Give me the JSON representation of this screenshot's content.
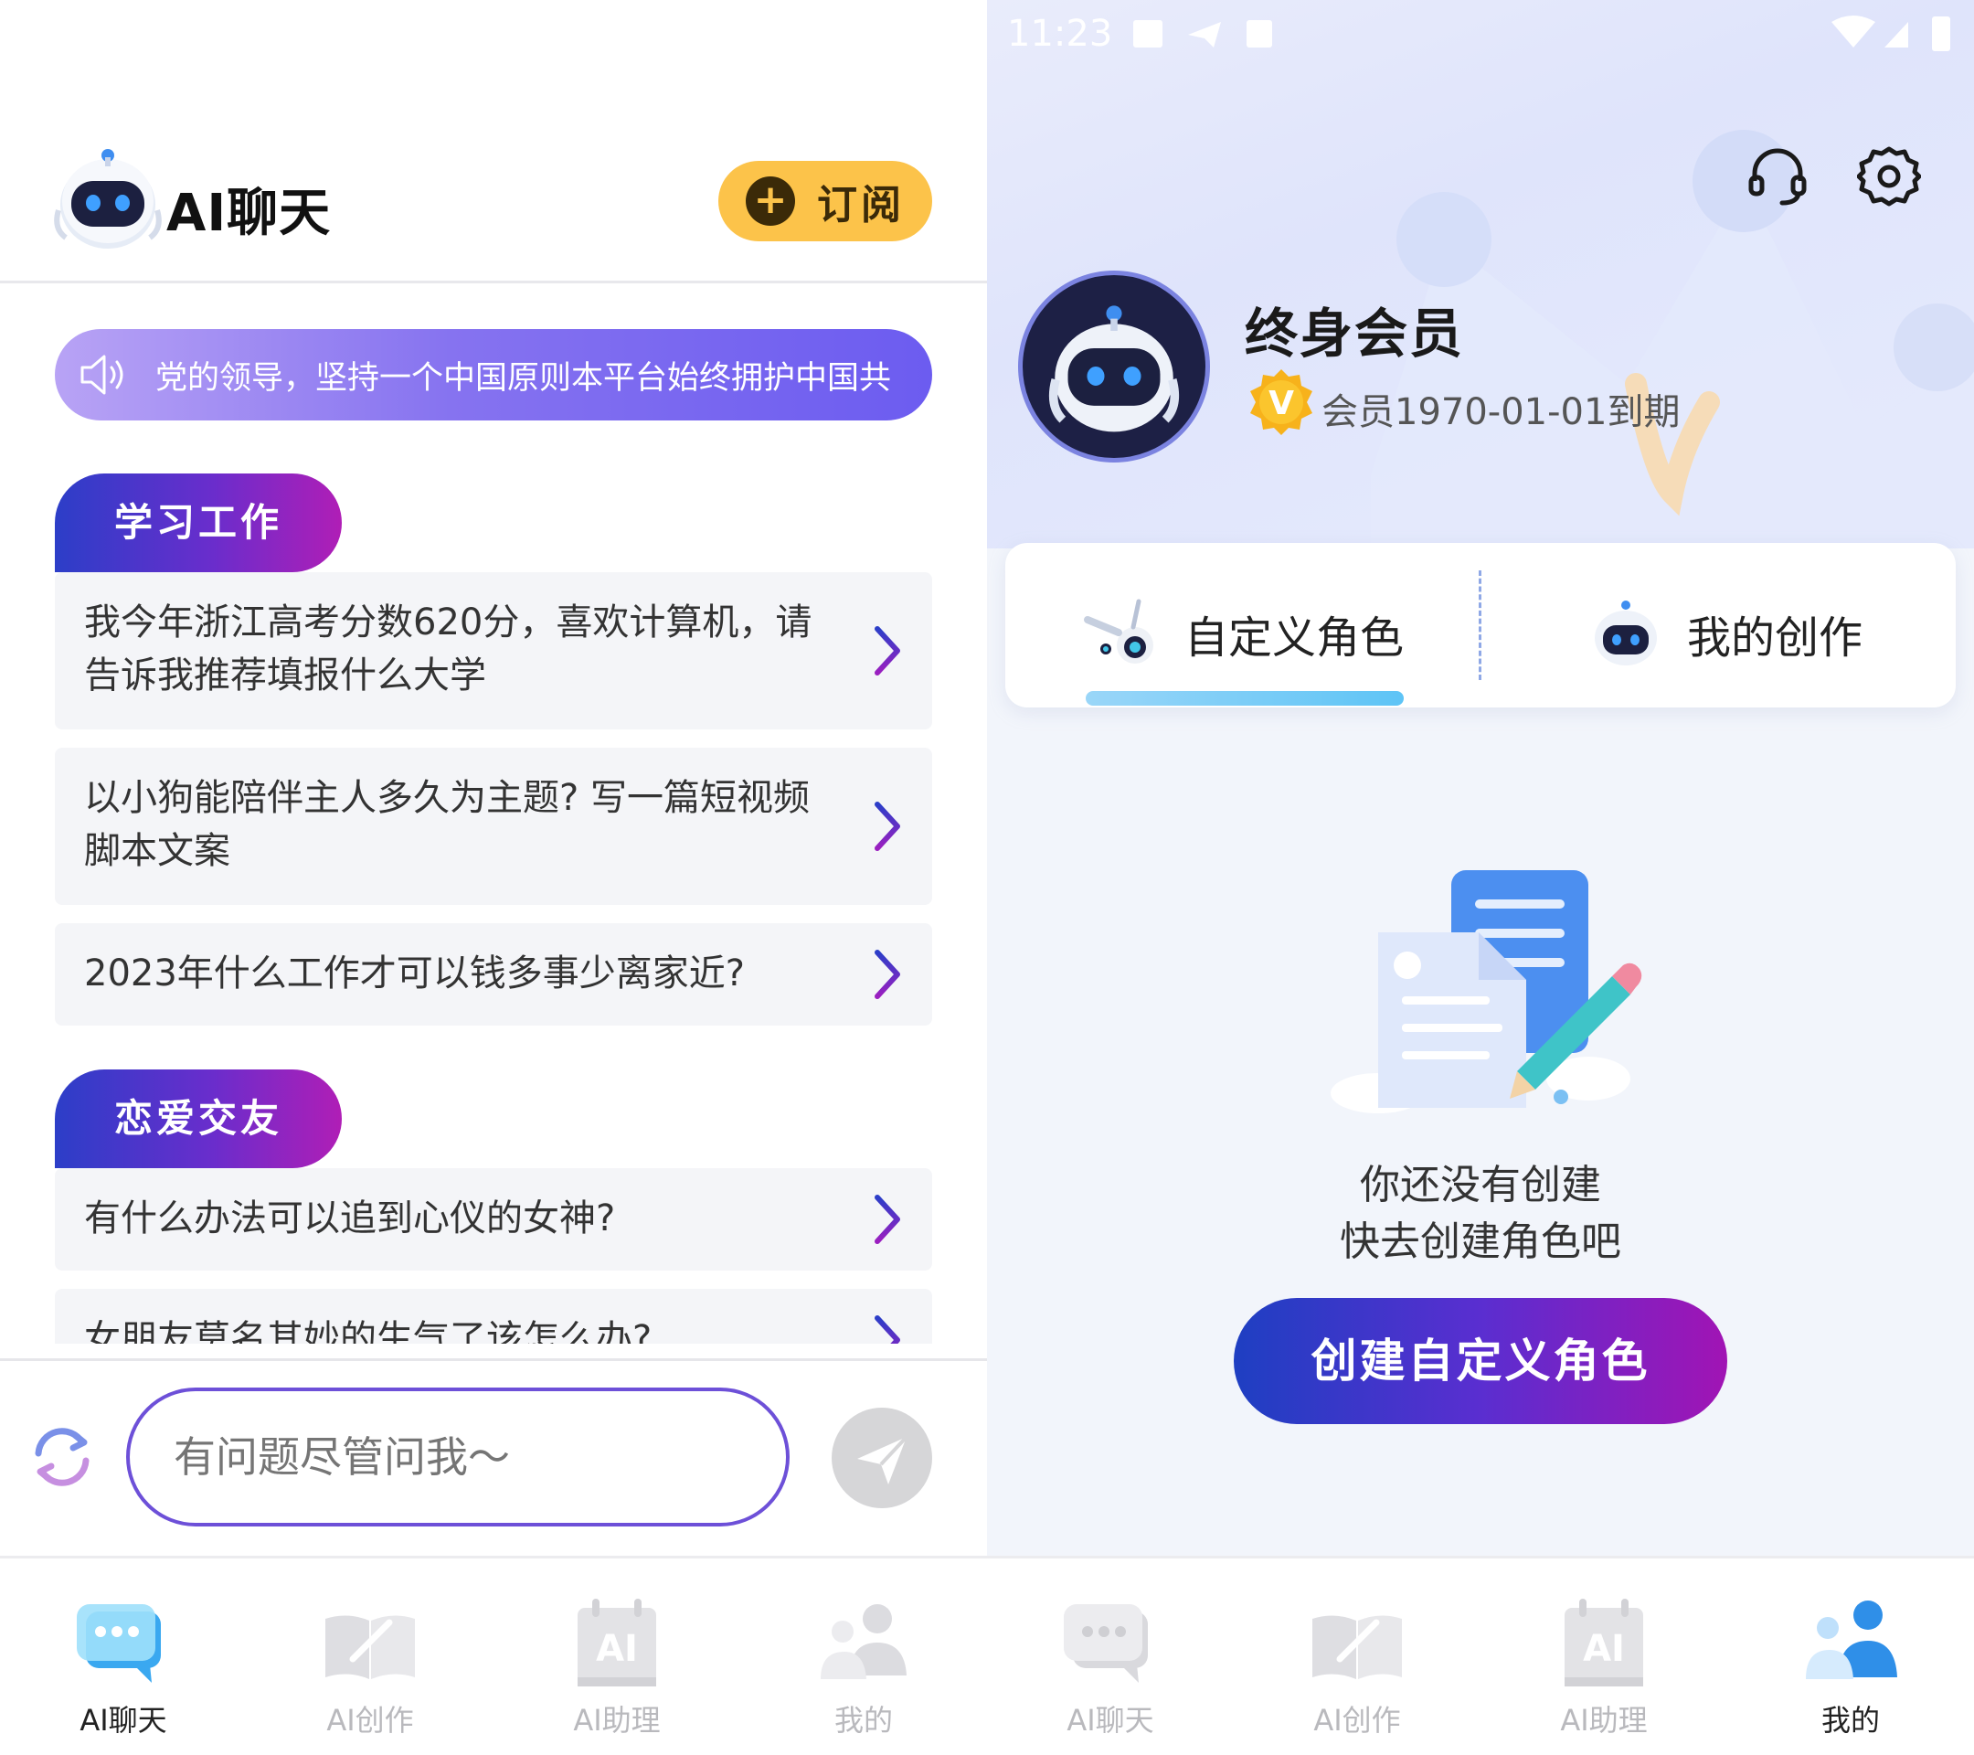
{
  "left": {
    "header": {
      "title": "AI聊天",
      "subscribe_label": "订阅",
      "logo_icon": "robot-logo-icon"
    },
    "notice": {
      "text": "党的领导，坚持一个中国原则本平台始终拥护中国共"
    },
    "sections": [
      {
        "tag": "学习工作",
        "questions": [
          "我今年浙江高考分数620分，喜欢计算机，请告诉我推荐填报什么大学",
          "以小狗能陪伴主人多久为主题? 写一篇短视频脚本文案",
          "2023年什么工作才可以钱多事少离家近?"
        ]
      },
      {
        "tag": "恋爱交友",
        "questions": [
          "有什么办法可以追到心仪的女神?",
          "女朋友莫名其妙的生气了该怎么办?"
        ]
      }
    ],
    "input": {
      "placeholder": "有问题尽管问我～"
    },
    "tabbar": {
      "items": [
        {
          "label": "AI聊天",
          "icon": "chat-bubble-icon",
          "active": true
        },
        {
          "label": "AI创作",
          "icon": "notebook-icon",
          "active": false
        },
        {
          "label": "AI助理",
          "icon": "ai-calendar-icon",
          "active": false
        },
        {
          "label": "我的",
          "icon": "user-icon",
          "active": false
        }
      ]
    }
  },
  "right": {
    "status": {
      "time": "11:23"
    },
    "profile": {
      "title": "终身会员",
      "badge": "V",
      "expiry": "会员1970-01-01到期"
    },
    "tabs": [
      {
        "label": "自定义角色",
        "icon": "bunny-robot-icon",
        "active": true
      },
      {
        "label": "我的创作",
        "icon": "robot-small-icon",
        "active": false
      }
    ],
    "empty": {
      "line1": "你还没有创建",
      "line2": "快去创建角色吧"
    },
    "create_button": "创建自定义角色",
    "tabbar": {
      "items": [
        {
          "label": "AI聊天",
          "icon": "chat-bubble-icon",
          "active": false
        },
        {
          "label": "AI创作",
          "icon": "notebook-icon",
          "active": false
        },
        {
          "label": "AI助理",
          "icon": "ai-calendar-icon",
          "active": false
        },
        {
          "label": "我的",
          "icon": "user-icon",
          "active": true
        }
      ]
    }
  },
  "colors": {
    "accent_purple": "#6d50d8",
    "subscribe_yellow": "#fcc34a",
    "tag_gradient_start": "#2c3ec8",
    "tag_gradient_end": "#b01eb6",
    "active_tab_blue": "#2f8fe8"
  }
}
